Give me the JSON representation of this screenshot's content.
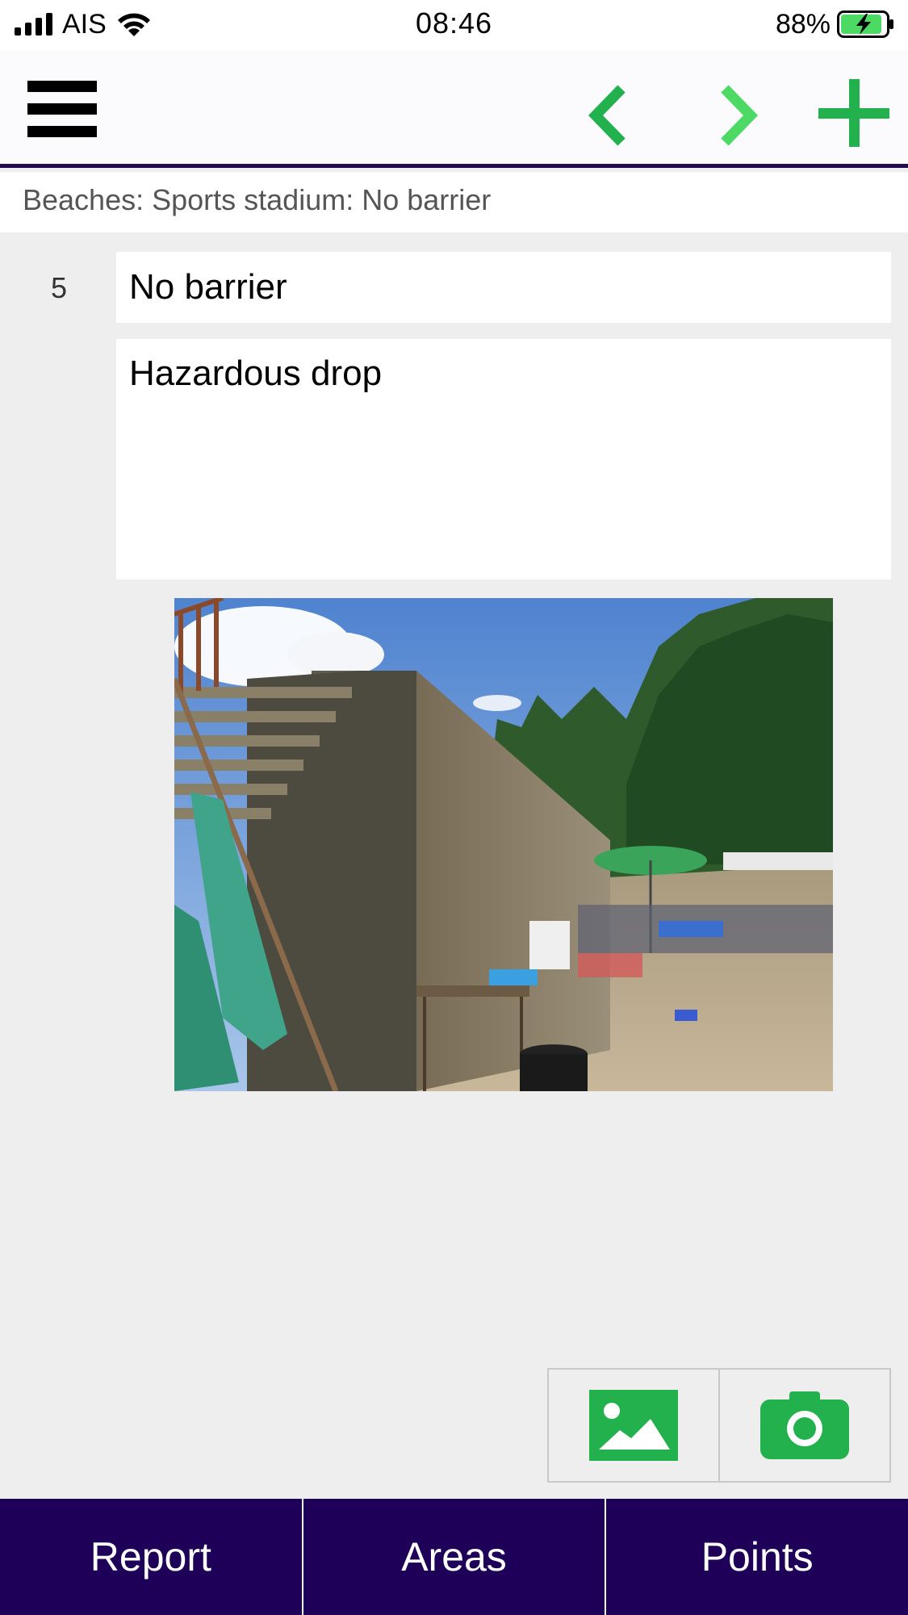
{
  "status_bar": {
    "carrier": "AIS",
    "time": "08:46",
    "battery_percent": "88%",
    "battery_level": 0.88,
    "battery_charging": true
  },
  "toolbar": {
    "menu_icon": "hamburger-menu-icon",
    "prev_icon": "chevron-left-icon",
    "next_icon": "chevron-right-icon",
    "add_icon": "plus-icon",
    "accent_color": "#22b14c",
    "accent_light_color": "#4cd964"
  },
  "breadcrumb": "Beaches: Sports stadium: No barrier",
  "item": {
    "number": "5",
    "title": "No barrier",
    "description": "Hazardous drop"
  },
  "media": {
    "gallery_icon": "image-gallery-icon",
    "camera_icon": "camera-icon"
  },
  "tabs": [
    {
      "label": "Report"
    },
    {
      "label": "Areas"
    },
    {
      "label": "Points"
    }
  ],
  "colors": {
    "tabbar_bg": "#1e0058",
    "divider": "#1f0a4f",
    "background": "#eeeeee"
  }
}
